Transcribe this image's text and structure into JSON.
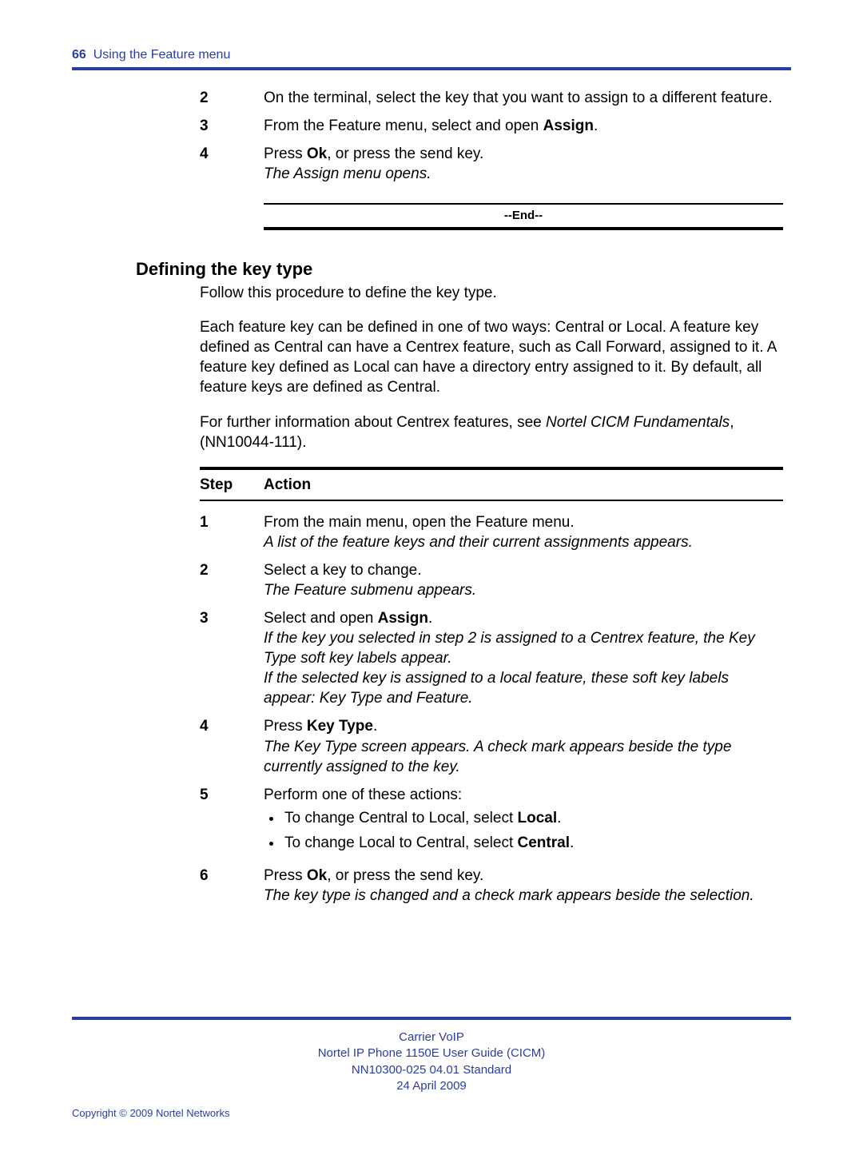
{
  "header": {
    "page_number": "66",
    "section_title": "Using the Feature menu"
  },
  "top_steps": [
    {
      "num": "2",
      "body": "On the terminal, select the key that you want to assign to a different feature."
    },
    {
      "num": "3",
      "body_prefix": " From the Feature menu, select and open ",
      "bold": "Assign",
      "body_suffix": "."
    },
    {
      "num": "4",
      "body_prefix": "Press ",
      "bold": "Ok",
      "body_suffix": ", or press the send key.",
      "italic": "The Assign menu opens."
    }
  ],
  "end_label": "--End--",
  "heading": "Defining the key type",
  "paras": [
    "Follow this procedure to define the key type.",
    "Each feature key can be defined in one of two ways: Central or Local. A feature key defined as Central can have a Centrex feature, such as Call Forward, assigned to it. A feature key defined as Local can have a directory entry assigned to it. By default, all feature keys are defined as Central."
  ],
  "para_ref": {
    "prefix": "For further information about Centrex features, see ",
    "italic": "Nortel CICM Fundamentals",
    "suffix": ", (NN10044-111)."
  },
  "step_table": {
    "h_step": "Step",
    "h_action": "Action",
    "rows": [
      {
        "num": "1",
        "line1": "From the main menu, open the Feature menu.",
        "italic": "A list of the feature keys and their current assignments appears."
      },
      {
        "num": "2",
        "line1": "Select a key to change.",
        "italic": "The Feature submenu appears."
      },
      {
        "num": "3",
        "line1_prefix": "Select and open ",
        "line1_bold": "Assign",
        "line1_suffix": ".",
        "italics": [
          "If the key you selected in step 2 is assigned to a Centrex feature, the Key Type soft key labels appear.",
          "If the selected key is assigned to a local feature, these soft key labels appear: Key Type and Feature."
        ]
      },
      {
        "num": "4",
        "line1_prefix": "Press ",
        "line1_bold": "Key Type",
        "line1_suffix": ".",
        "italic": "The Key Type screen appears. A check mark appears beside the type currently assigned to the key."
      },
      {
        "num": "5",
        "line1": "Perform one of these actions:",
        "bullets": [
          {
            "prefix": "To change Central to Local, select ",
            "bold": "Local",
            "suffix": "."
          },
          {
            "prefix": "To change Local to Central, select ",
            "bold": "Central",
            "suffix": "."
          }
        ]
      },
      {
        "num": "6",
        "line1_prefix": "Press ",
        "line1_bold": "Ok",
        "line1_suffix": ", or press the send key.",
        "italic": "The key type is changed and a check mark appears beside the selection."
      }
    ]
  },
  "footer": {
    "lines": [
      "Carrier VoIP",
      "Nortel IP Phone 1150E User Guide (CICM)",
      "NN10300-025   04.01   Standard",
      "24 April 2009"
    ],
    "copyright": "Copyright © 2009 Nortel Networks"
  }
}
